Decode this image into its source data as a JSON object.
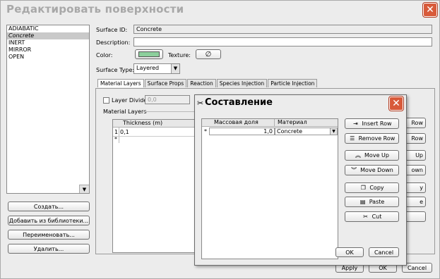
{
  "window": {
    "title": "Редактировать поверхности",
    "close": "✕"
  },
  "surface_list": [
    "ADIABATIC",
    "Concrete",
    "INERT",
    "MIRROR",
    "OPEN"
  ],
  "selected_surface": "Concrete",
  "left_buttons": {
    "create": "Создать...",
    "add_from_library": "Добавить из библиотеки...",
    "rename": "Переименовать...",
    "delete": "Удалить..."
  },
  "props": {
    "surface_id_label": "Surface ID:",
    "surface_id_value": "Concrete",
    "description_label": "Description:",
    "description_value": "",
    "color_label": "Color:",
    "color_value": "#8ccf9c",
    "texture_label": "Texture:",
    "texture_icon": "∅",
    "surface_type_label": "Surface Type:",
    "surface_type_value": "Layered"
  },
  "tabs": [
    "Material Layers",
    "Surface Props",
    "Reaction",
    "Species Injection",
    "Particle Injection"
  ],
  "material_layers": {
    "layer_divide_label": "Layer Divide:",
    "layer_divide_value": "0,0",
    "group_label": "Material Layers",
    "thickness_header": "Thickness (m)",
    "rows": [
      {
        "index": "1",
        "thickness": "0,1"
      }
    ],
    "new_row_marker": "*"
  },
  "partial_buttons": [
    "Row",
    "Row",
    "Up",
    "own",
    "y",
    "e"
  ],
  "bottom_buttons": {
    "apply": "Apply",
    "ok": "OK",
    "cancel": "Cancel"
  },
  "dialog": {
    "title": "Составление",
    "close": "✕",
    "col_mass_fraction": "Массовая доля",
    "col_material": "Материал",
    "row": {
      "marker": "*",
      "mass_fraction": "1,0",
      "material": "Concrete"
    },
    "buttons": {
      "insert_row": "Insert Row",
      "remove_row": "Remove Row",
      "move_up": "Move Up",
      "move_down": "Move Down",
      "copy": "Copy",
      "paste": "Paste",
      "cut": "Cut",
      "ok": "OK",
      "cancel": "Cancel"
    }
  }
}
